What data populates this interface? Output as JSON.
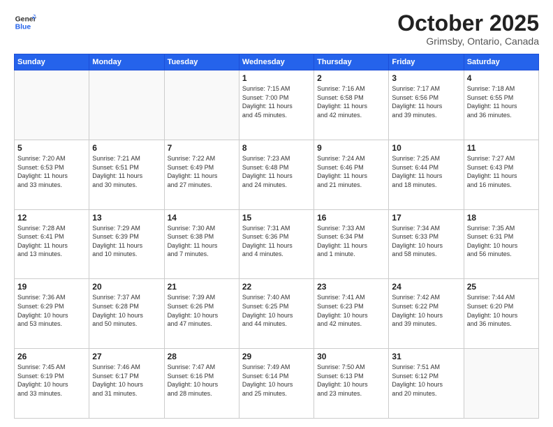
{
  "header": {
    "logo_line1": "General",
    "logo_line2": "Blue",
    "month": "October 2025",
    "location": "Grimsby, Ontario, Canada"
  },
  "weekdays": [
    "Sunday",
    "Monday",
    "Tuesday",
    "Wednesday",
    "Thursday",
    "Friday",
    "Saturday"
  ],
  "weeks": [
    [
      {
        "day": "",
        "info": ""
      },
      {
        "day": "",
        "info": ""
      },
      {
        "day": "",
        "info": ""
      },
      {
        "day": "1",
        "info": "Sunrise: 7:15 AM\nSunset: 7:00 PM\nDaylight: 11 hours\nand 45 minutes."
      },
      {
        "day": "2",
        "info": "Sunrise: 7:16 AM\nSunset: 6:58 PM\nDaylight: 11 hours\nand 42 minutes."
      },
      {
        "day": "3",
        "info": "Sunrise: 7:17 AM\nSunset: 6:56 PM\nDaylight: 11 hours\nand 39 minutes."
      },
      {
        "day": "4",
        "info": "Sunrise: 7:18 AM\nSunset: 6:55 PM\nDaylight: 11 hours\nand 36 minutes."
      }
    ],
    [
      {
        "day": "5",
        "info": "Sunrise: 7:20 AM\nSunset: 6:53 PM\nDaylight: 11 hours\nand 33 minutes."
      },
      {
        "day": "6",
        "info": "Sunrise: 7:21 AM\nSunset: 6:51 PM\nDaylight: 11 hours\nand 30 minutes."
      },
      {
        "day": "7",
        "info": "Sunrise: 7:22 AM\nSunset: 6:49 PM\nDaylight: 11 hours\nand 27 minutes."
      },
      {
        "day": "8",
        "info": "Sunrise: 7:23 AM\nSunset: 6:48 PM\nDaylight: 11 hours\nand 24 minutes."
      },
      {
        "day": "9",
        "info": "Sunrise: 7:24 AM\nSunset: 6:46 PM\nDaylight: 11 hours\nand 21 minutes."
      },
      {
        "day": "10",
        "info": "Sunrise: 7:25 AM\nSunset: 6:44 PM\nDaylight: 11 hours\nand 18 minutes."
      },
      {
        "day": "11",
        "info": "Sunrise: 7:27 AM\nSunset: 6:43 PM\nDaylight: 11 hours\nand 16 minutes."
      }
    ],
    [
      {
        "day": "12",
        "info": "Sunrise: 7:28 AM\nSunset: 6:41 PM\nDaylight: 11 hours\nand 13 minutes."
      },
      {
        "day": "13",
        "info": "Sunrise: 7:29 AM\nSunset: 6:39 PM\nDaylight: 11 hours\nand 10 minutes."
      },
      {
        "day": "14",
        "info": "Sunrise: 7:30 AM\nSunset: 6:38 PM\nDaylight: 11 hours\nand 7 minutes."
      },
      {
        "day": "15",
        "info": "Sunrise: 7:31 AM\nSunset: 6:36 PM\nDaylight: 11 hours\nand 4 minutes."
      },
      {
        "day": "16",
        "info": "Sunrise: 7:33 AM\nSunset: 6:34 PM\nDaylight: 11 hours\nand 1 minute."
      },
      {
        "day": "17",
        "info": "Sunrise: 7:34 AM\nSunset: 6:33 PM\nDaylight: 10 hours\nand 58 minutes."
      },
      {
        "day": "18",
        "info": "Sunrise: 7:35 AM\nSunset: 6:31 PM\nDaylight: 10 hours\nand 56 minutes."
      }
    ],
    [
      {
        "day": "19",
        "info": "Sunrise: 7:36 AM\nSunset: 6:29 PM\nDaylight: 10 hours\nand 53 minutes."
      },
      {
        "day": "20",
        "info": "Sunrise: 7:37 AM\nSunset: 6:28 PM\nDaylight: 10 hours\nand 50 minutes."
      },
      {
        "day": "21",
        "info": "Sunrise: 7:39 AM\nSunset: 6:26 PM\nDaylight: 10 hours\nand 47 minutes."
      },
      {
        "day": "22",
        "info": "Sunrise: 7:40 AM\nSunset: 6:25 PM\nDaylight: 10 hours\nand 44 minutes."
      },
      {
        "day": "23",
        "info": "Sunrise: 7:41 AM\nSunset: 6:23 PM\nDaylight: 10 hours\nand 42 minutes."
      },
      {
        "day": "24",
        "info": "Sunrise: 7:42 AM\nSunset: 6:22 PM\nDaylight: 10 hours\nand 39 minutes."
      },
      {
        "day": "25",
        "info": "Sunrise: 7:44 AM\nSunset: 6:20 PM\nDaylight: 10 hours\nand 36 minutes."
      }
    ],
    [
      {
        "day": "26",
        "info": "Sunrise: 7:45 AM\nSunset: 6:19 PM\nDaylight: 10 hours\nand 33 minutes."
      },
      {
        "day": "27",
        "info": "Sunrise: 7:46 AM\nSunset: 6:17 PM\nDaylight: 10 hours\nand 31 minutes."
      },
      {
        "day": "28",
        "info": "Sunrise: 7:47 AM\nSunset: 6:16 PM\nDaylight: 10 hours\nand 28 minutes."
      },
      {
        "day": "29",
        "info": "Sunrise: 7:49 AM\nSunset: 6:14 PM\nDaylight: 10 hours\nand 25 minutes."
      },
      {
        "day": "30",
        "info": "Sunrise: 7:50 AM\nSunset: 6:13 PM\nDaylight: 10 hours\nand 23 minutes."
      },
      {
        "day": "31",
        "info": "Sunrise: 7:51 AM\nSunset: 6:12 PM\nDaylight: 10 hours\nand 20 minutes."
      },
      {
        "day": "",
        "info": ""
      }
    ]
  ]
}
